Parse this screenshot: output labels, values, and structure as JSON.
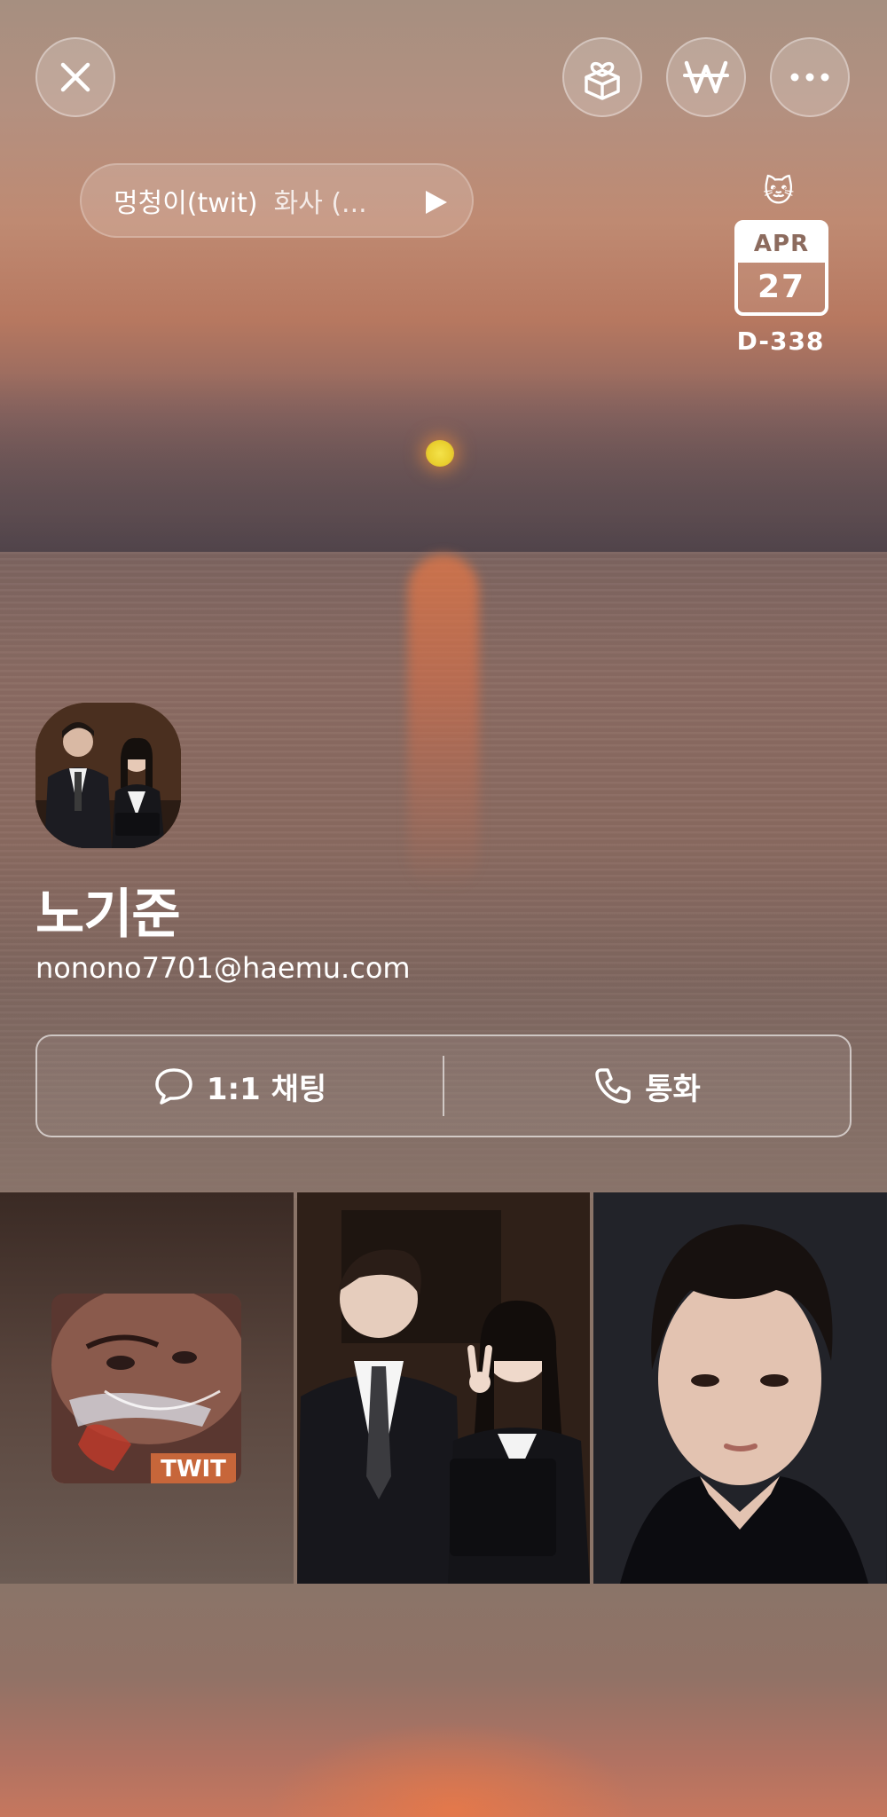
{
  "header": {
    "close_icon": "close-icon",
    "gift_icon": "gift-box-heart-icon",
    "money_icon": "won-sign-icon",
    "more_icon": "more-horizontal-icon"
  },
  "music": {
    "song": "멍청이(twit)",
    "artist": "화사 (...",
    "play_icon": "play-icon"
  },
  "dday": {
    "sticker": "🐱",
    "month": "APR",
    "day": "27",
    "count": "D-338"
  },
  "profile": {
    "name": "노기준",
    "email": "nonono7701@haemu.com"
  },
  "actions": {
    "chat_label": "1:1 채팅",
    "call_label": "통화"
  },
  "grid": {
    "album_label": "TWIT"
  },
  "colors": {
    "sunset_orange": "#c8704f",
    "album_label": "#c7663a"
  }
}
